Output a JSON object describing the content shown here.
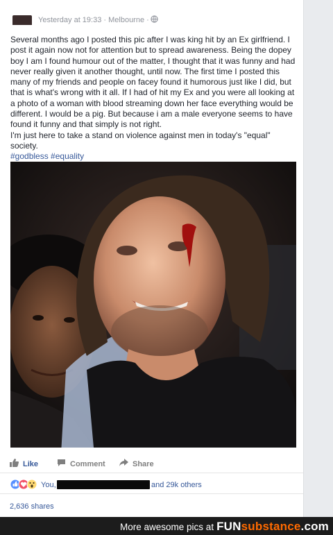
{
  "post": {
    "timestamp": "Yesterday at 19:33 · Melbourne ·",
    "paragraphs": [
      "Several months ago I posted this pic after I was king hit by an Ex girlfriend. I post it again now not for attention but to spread awareness. Being the dopey boy I am I found humour out of the matter, I thought that it was funny and had never really given it another thought, until now. The first time I posted this many of my friends and people on facey found it humorous just like I did, but that is what's wrong with it all. If I had of hit my Ex and you were all looking at a photo of a woman with blood streaming down her face everything would be different. I would be a pig. But because i am a male everyone seems to have found it funny and that simply is not right.",
      "I'm just here to take a stand on violence against men in today's \"equal\" society."
    ],
    "hashtags": "#godbless #equality",
    "icons": {
      "privacy": "globe-icon"
    }
  },
  "actions": {
    "like": "Like",
    "comment": "Comment",
    "share": "Share",
    "icons": [
      "thumbs-up-icon",
      "comment-icon",
      "share-arrow-icon"
    ]
  },
  "reactions": {
    "you": "You,",
    "others": "and 29k others",
    "icons": [
      "like-reaction-icon",
      "love-reaction-icon",
      "wow-reaction-icon"
    ]
  },
  "shares": "2,636 shares",
  "footer": {
    "text": "More awesome pics at",
    "brand_fun": "FUN",
    "brand_sub": "substance",
    "brand_tld": ".com",
    "brand_color": "#ff6a00"
  },
  "colors": {
    "link": "#365899",
    "muted": "#90949c",
    "text": "#1d2129"
  }
}
